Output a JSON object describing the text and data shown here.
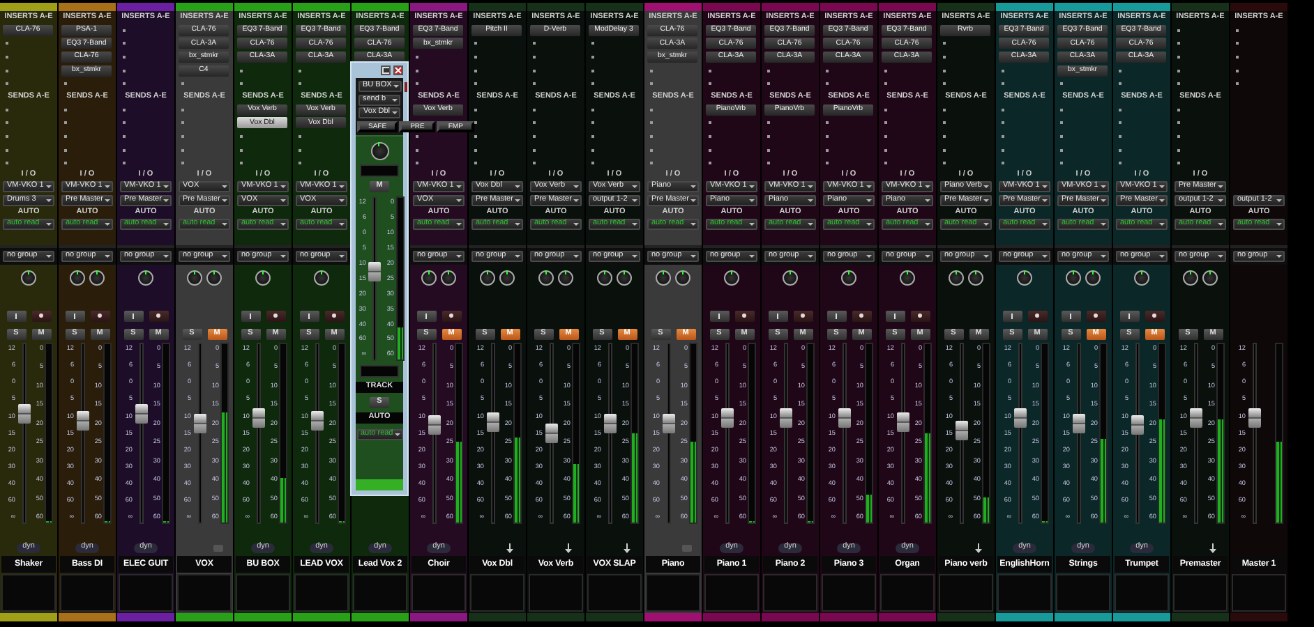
{
  "channels": [
    {
      "name": "Shaker",
      "kind": "audio",
      "color": "#a0a018",
      "selected": false,
      "stereo": false,
      "record_buttons": true,
      "muted": false,
      "inserts_label": "INSERTS A-E",
      "inserts": [
        "CLA-76"
      ],
      "sends_label": "SENDS A-E",
      "io_label": "I / O",
      "input": "VM-VKO 1",
      "output": "Drums 3",
      "auto_label": "AUTO",
      "automation": "auto read",
      "group": "no group",
      "solo_label": "S",
      "mute_label": "M",
      "dyn": "dyn",
      "fader": {
        "level": 0.62,
        "scale": [
          "12",
          "6",
          "0",
          "5",
          "10",
          "15",
          "20",
          "30",
          "40",
          "60",
          "∞"
        ]
      },
      "meter": {
        "level": 0,
        "scale": [
          "0",
          "5",
          "10",
          "15",
          "20",
          "25",
          "30",
          "40",
          "50",
          "60"
        ]
      }
    },
    {
      "name": "Bass DI",
      "kind": "audio",
      "color": "#a87018",
      "selected": false,
      "stereo": true,
      "record_buttons": true,
      "muted": false,
      "inserts_label": "INSERTS A-E",
      "inserts": [
        "PSA-1",
        "EQ3 7-Band",
        "CLA-76",
        "bx_stmkr"
      ],
      "sends_label": "SENDS A-E",
      "io_label": "I / O",
      "input": "VM-VKO 1",
      "output": "Pre Master",
      "auto_label": "AUTO",
      "automation": "auto read",
      "group": "no group",
      "solo_label": "S",
      "mute_label": "M",
      "dyn": "dyn",
      "fader": {
        "level": 0.58,
        "scale": [
          "12",
          "6",
          "0",
          "5",
          "10",
          "15",
          "20",
          "30",
          "40",
          "60",
          "∞"
        ]
      },
      "meter": {
        "level": 0,
        "scale": [
          "0",
          "5",
          "10",
          "15",
          "20",
          "25",
          "30",
          "40",
          "50",
          "60"
        ]
      }
    },
    {
      "name": "ELEC GUIT",
      "kind": "audio",
      "color": "#6a20a0",
      "selected": false,
      "stereo": false,
      "record_buttons": true,
      "muted": false,
      "inserts_label": "INSERTS A-E",
      "sends_label": "SENDS A-E",
      "io_label": "I / O",
      "input": "VM-VKO 1",
      "output": "Pre Master",
      "auto_label": "AUTO",
      "automation": "auto read",
      "group": "no group",
      "solo_label": "S",
      "mute_label": "M",
      "dyn": "dyn",
      "fader": {
        "level": 0.62,
        "scale": [
          "12",
          "6",
          "0",
          "5",
          "10",
          "15",
          "20",
          "30",
          "40",
          "60",
          "∞"
        ]
      },
      "meter": {
        "level": 0,
        "scale": [
          "0",
          "5",
          "10",
          "15",
          "20",
          "25",
          "30",
          "40",
          "50",
          "60"
        ]
      }
    },
    {
      "name": "VOX",
      "kind": "folder",
      "color": "#28a018",
      "selected": true,
      "stereo": true,
      "record_buttons": false,
      "muted": true,
      "inserts_label": "INSERTS A-E",
      "inserts": [
        "CLA-76",
        "CLA-3A",
        "bx_stmkr",
        "C4"
      ],
      "sends_label": "SENDS A-E",
      "io_label": "I / O",
      "input": "VOX",
      "output": "Pre Master",
      "auto_label": "AUTO",
      "automation": "auto read",
      "group": "no group",
      "solo_label": "S",
      "mute_label": "M",
      "fader": {
        "level": 0.56,
        "scale": [
          "12",
          "6",
          "0",
          "5",
          "10",
          "15",
          "20",
          "30",
          "40",
          "60",
          "∞"
        ]
      },
      "meter": {
        "level": 0.62,
        "scale": [
          "0",
          "5",
          "10",
          "15",
          "20",
          "25",
          "30",
          "40",
          "50",
          "60"
        ]
      }
    },
    {
      "name": "BU BOX",
      "kind": "audio",
      "color": "#28a018",
      "selected": false,
      "stereo": false,
      "record_buttons": true,
      "muted": false,
      "inserts_label": "INSERTS A-E",
      "inserts": [
        "EQ3 7-Band",
        "CLA-76",
        "CLA-3A"
      ],
      "sends_label": "SENDS A-E",
      "sends": [
        {
          "label": "Vox Verb",
          "selected": false
        },
        {
          "label": "Vox Dbl",
          "selected": true
        }
      ],
      "io_label": "I / O",
      "input": "VM-VKO 1",
      "output": "VOX",
      "auto_label": "AUTO",
      "automation": "auto read",
      "group": "no group",
      "solo_label": "S",
      "mute_label": "M",
      "dyn": "dyn",
      "fader": {
        "level": 0.6,
        "scale": [
          "12",
          "6",
          "0",
          "5",
          "10",
          "15",
          "20",
          "30",
          "40",
          "60",
          "∞"
        ]
      },
      "meter": {
        "level": 0.25,
        "scale": [
          "0",
          "5",
          "10",
          "15",
          "20",
          "25",
          "30",
          "40",
          "50",
          "60"
        ]
      }
    },
    {
      "name": "LEAD VOX",
      "kind": "audio",
      "color": "#28a018",
      "selected": false,
      "stereo": false,
      "record_buttons": true,
      "muted": false,
      "inserts_label": "INSERTS A-E",
      "inserts": [
        "EQ3 7-Band",
        "CLA-76",
        "CLA-3A"
      ],
      "sends_label": "SENDS A-E",
      "sends": [
        {
          "label": "Vox Verb",
          "selected": false
        },
        {
          "label": "Vox Dbl",
          "selected": false
        }
      ],
      "io_label": "I / O",
      "input": "VM-VKO 1",
      "output": "VOX",
      "auto_label": "AUTO",
      "automation": "auto read",
      "group": "no group",
      "solo_label": "S",
      "mute_label": "M",
      "dyn": "dyn",
      "fader": {
        "level": 0.58,
        "scale": [
          "12",
          "6",
          "0",
          "5",
          "10",
          "15",
          "20",
          "30",
          "40",
          "60",
          "∞"
        ]
      },
      "meter": {
        "level": 0,
        "scale": [
          "0",
          "5",
          "10",
          "15",
          "20",
          "25",
          "30",
          "40",
          "50",
          "60"
        ]
      }
    },
    {
      "name": "Lead Vox 2",
      "kind": "audio",
      "color": "#28a018",
      "selected": false,
      "inserts_label": "INSERTS A-E",
      "inserts": [
        "EQ3 7-Band",
        "CLA-76",
        "CLA-3A"
      ],
      "dyn": "dyn"
    },
    {
      "name": "Choir",
      "kind": "audio",
      "color": "#8a1880",
      "selected": false,
      "stereo": true,
      "record_buttons": true,
      "muted": true,
      "inserts_label": "INSERTS A-E",
      "inserts": [
        "EQ3 7-Band",
        "bx_stmkr"
      ],
      "sends_label": "SENDS A-E",
      "sends": [
        {
          "label": "Vox Verb",
          "selected": false
        }
      ],
      "io_label": "I / O",
      "input": "VM-VKO 1",
      "output": "VOX",
      "auto_label": "AUTO",
      "automation": "auto read",
      "group": "no group",
      "solo_label": "S",
      "mute_label": "M",
      "dyn": "dyn",
      "fader": {
        "level": 0.55,
        "scale": [
          "12",
          "6",
          "0",
          "5",
          "10",
          "15",
          "20",
          "30",
          "40",
          "60",
          "∞"
        ]
      },
      "meter": {
        "level": 0.45,
        "scale": [
          "0",
          "5",
          "10",
          "15",
          "20",
          "25",
          "30",
          "40",
          "50",
          "60"
        ]
      }
    },
    {
      "name": "Vox Dbl",
      "kind": "aux",
      "color": "#16301a",
      "selected": false,
      "stereo": true,
      "record_buttons": false,
      "muted": true,
      "inserts_label": "INSERTS A-E",
      "inserts": [
        "Pitch II"
      ],
      "sends_label": "SENDS A-E",
      "io_label": "I / O",
      "input": "Vox Dbl",
      "output": "Pre Master",
      "auto_label": "AUTO",
      "automation": "auto read",
      "group": "no group",
      "solo_label": "S",
      "mute_label": "M",
      "fader": {
        "level": 0.57,
        "scale": [
          "12",
          "6",
          "0",
          "5",
          "10",
          "15",
          "20",
          "30",
          "40",
          "60",
          "∞"
        ]
      },
      "meter": {
        "level": 0.48,
        "scale": [
          "0",
          "5",
          "10",
          "15",
          "20",
          "25",
          "30",
          "40",
          "50",
          "60"
        ]
      }
    },
    {
      "name": "Vox Verb",
      "kind": "aux",
      "color": "#16301a",
      "selected": false,
      "stereo": true,
      "record_buttons": false,
      "muted": true,
      "inserts_label": "INSERTS A-E",
      "inserts": [
        "D-Verb"
      ],
      "sends_label": "SENDS A-E",
      "io_label": "I / O",
      "input": "Vox Verb",
      "output": "Pre Master",
      "auto_label": "AUTO",
      "automation": "auto read",
      "group": "no group",
      "solo_label": "S",
      "mute_label": "M",
      "fader": {
        "level": 0.5,
        "scale": [
          "12",
          "6",
          "0",
          "5",
          "10",
          "15",
          "20",
          "30",
          "40",
          "60",
          "∞"
        ]
      },
      "meter": {
        "level": 0.33,
        "scale": [
          "0",
          "5",
          "10",
          "15",
          "20",
          "25",
          "30",
          "40",
          "50",
          "60"
        ]
      }
    },
    {
      "name": "VOX SLAP",
      "kind": "aux",
      "color": "#16301a",
      "selected": false,
      "stereo": true,
      "record_buttons": false,
      "muted": true,
      "inserts_label": "INSERTS A-E",
      "inserts": [
        "ModDelay 3"
      ],
      "sends_label": "SENDS A-E",
      "io_label": "I / O",
      "input": "Vox Verb",
      "output": "output 1-2",
      "auto_label": "AUTO",
      "automation": "auto read",
      "group": "no group",
      "solo_label": "S",
      "mute_label": "M",
      "fader": {
        "level": 0.56,
        "scale": [
          "12",
          "6",
          "0",
          "5",
          "10",
          "15",
          "20",
          "30",
          "40",
          "60",
          "∞"
        ]
      },
      "meter": {
        "level": 0.5,
        "scale": [
          "0",
          "5",
          "10",
          "15",
          "20",
          "25",
          "30",
          "40",
          "50",
          "60"
        ]
      }
    },
    {
      "name": "Piano",
      "kind": "folder",
      "color": "#a01070",
      "selected": true,
      "stereo": true,
      "record_buttons": false,
      "muted": true,
      "inserts_label": "INSERTS A-E",
      "inserts": [
        "CLA-76",
        "CLA-3A",
        "bx_stmkr"
      ],
      "sends_label": "SENDS A-E",
      "io_label": "I / O",
      "input": "Piano",
      "output": "Pre Master",
      "auto_label": "AUTO",
      "automation": "auto read",
      "group": "no group",
      "solo_label": "S",
      "mute_label": "M",
      "fader": {
        "level": 0.56,
        "scale": [
          "12",
          "6",
          "0",
          "5",
          "10",
          "15",
          "20",
          "30",
          "40",
          "60",
          "∞"
        ]
      },
      "meter": {
        "level": 0.45,
        "scale": [
          "0",
          "5",
          "10",
          "15",
          "20",
          "25",
          "30",
          "40",
          "50",
          "60"
        ]
      }
    },
    {
      "name": "Piano 1",
      "kind": "audio",
      "color": "#7a0850",
      "selected": false,
      "stereo": false,
      "record_buttons": true,
      "muted": false,
      "inserts_label": "INSERTS A-E",
      "inserts": [
        "EQ3 7-Band",
        "CLA-76",
        "CLA-3A"
      ],
      "sends_label": "SENDS A-E",
      "sends": [
        {
          "label": "PianoVrb",
          "selected": false
        }
      ],
      "io_label": "I / O",
      "input": "VM-VKO 1",
      "output": "Piano",
      "auto_label": "AUTO",
      "automation": "auto read",
      "group": "no group",
      "solo_label": "S",
      "mute_label": "M",
      "dyn": "dyn",
      "fader": {
        "level": 0.6,
        "scale": [
          "12",
          "6",
          "0",
          "5",
          "10",
          "15",
          "20",
          "30",
          "40",
          "60",
          "∞"
        ]
      },
      "meter": {
        "level": 0,
        "scale": [
          "0",
          "5",
          "10",
          "15",
          "20",
          "25",
          "30",
          "40",
          "50",
          "60"
        ]
      }
    },
    {
      "name": "Piano 2",
      "kind": "audio",
      "color": "#7a0850",
      "selected": false,
      "stereo": false,
      "record_buttons": true,
      "muted": false,
      "inserts_label": "INSERTS A-E",
      "inserts": [
        "EQ3 7-Band",
        "CLA-76",
        "CLA-3A"
      ],
      "sends_label": "SENDS A-E",
      "sends": [
        {
          "label": "PianoVrb",
          "selected": false
        }
      ],
      "io_label": "I / O",
      "input": "VM-VKO 1",
      "output": "Piano",
      "auto_label": "AUTO",
      "automation": "auto read",
      "group": "no group",
      "solo_label": "S",
      "mute_label": "M",
      "dyn": "dyn",
      "fader": {
        "level": 0.6,
        "scale": [
          "12",
          "6",
          "0",
          "5",
          "10",
          "15",
          "20",
          "30",
          "40",
          "60",
          "∞"
        ]
      },
      "meter": {
        "level": 0,
        "scale": [
          "0",
          "5",
          "10",
          "15",
          "20",
          "25",
          "30",
          "40",
          "50",
          "60"
        ]
      }
    },
    {
      "name": "Piano 3",
      "kind": "audio",
      "color": "#7a0850",
      "selected": false,
      "stereo": false,
      "record_buttons": true,
      "muted": false,
      "inserts_label": "INSERTS A-E",
      "inserts": [
        "EQ3 7-Band",
        "CLA-76",
        "CLA-3A"
      ],
      "sends_label": "SENDS A-E",
      "sends": [
        {
          "label": "PianoVrb",
          "selected": false
        }
      ],
      "io_label": "I / O",
      "input": "VM-VKO 1",
      "output": "Piano",
      "auto_label": "AUTO",
      "automation": "auto read",
      "group": "no group",
      "solo_label": "S",
      "mute_label": "M",
      "dyn": "dyn",
      "fader": {
        "level": 0.6,
        "scale": [
          "12",
          "6",
          "0",
          "5",
          "10",
          "15",
          "20",
          "30",
          "40",
          "60",
          "∞"
        ]
      },
      "meter": {
        "level": 0.16,
        "scale": [
          "0",
          "5",
          "10",
          "15",
          "20",
          "25",
          "30",
          "40",
          "50",
          "60"
        ]
      }
    },
    {
      "name": "Organ",
      "kind": "audio",
      "color": "#7a0850",
      "selected": false,
      "stereo": false,
      "record_buttons": true,
      "muted": false,
      "inserts_label": "INSERTS A-E",
      "inserts": [
        "EQ3 7-Band",
        "CLA-76",
        "CLA-3A"
      ],
      "sends_label": "SENDS A-E",
      "io_label": "I / O",
      "input": "VM-VKO 1",
      "output": "Piano",
      "auto_label": "AUTO",
      "automation": "auto read",
      "group": "no group",
      "solo_label": "S",
      "mute_label": "M",
      "dyn": "dyn",
      "fader": {
        "level": 0.57,
        "scale": [
          "12",
          "6",
          "0",
          "5",
          "10",
          "15",
          "20",
          "30",
          "40",
          "60",
          "∞"
        ]
      },
      "meter": {
        "level": 0.5,
        "scale": [
          "0",
          "5",
          "10",
          "15",
          "20",
          "25",
          "30",
          "40",
          "50",
          "60"
        ]
      }
    },
    {
      "name": "Piano verb",
      "kind": "aux",
      "color": "#16301a",
      "selected": false,
      "stereo": true,
      "record_buttons": false,
      "muted": false,
      "inserts_label": "INSERTS A-E",
      "inserts": [
        "Rvrb"
      ],
      "sends_label": "SENDS A-E",
      "io_label": "I / O",
      "input": "Piano Verb",
      "output": "Pre Master",
      "auto_label": "AUTO",
      "automation": "auto read",
      "group": "no group",
      "solo_label": "S",
      "mute_label": "M",
      "fader": {
        "level": 0.52,
        "scale": [
          "12",
          "6",
          "0",
          "5",
          "10",
          "15",
          "20",
          "30",
          "40",
          "60",
          "∞"
        ]
      },
      "meter": {
        "level": 0.14,
        "scale": [
          "0",
          "5",
          "10",
          "15",
          "20",
          "25",
          "30",
          "40",
          "50",
          "60"
        ]
      }
    },
    {
      "name": "EnglishHorn",
      "kind": "audio",
      "color": "#189a9a",
      "selected": false,
      "stereo": false,
      "record_buttons": true,
      "muted": false,
      "inserts_label": "INSERTS A-E",
      "inserts": [
        "EQ3 7-Band",
        "CLA-76",
        "CLA-3A"
      ],
      "sends_label": "SENDS A-E",
      "io_label": "I / O",
      "input": "VM-VKO 1",
      "output": "Pre Master",
      "auto_label": "AUTO",
      "automation": "auto read",
      "group": "no group",
      "solo_label": "S",
      "mute_label": "M",
      "dyn": "dyn",
      "fader": {
        "level": 0.6,
        "scale": [
          "12",
          "6",
          "0",
          "5",
          "10",
          "15",
          "20",
          "30",
          "40",
          "60",
          "∞"
        ]
      },
      "meter": {
        "level": 0,
        "scale": [
          "0",
          "5",
          "10",
          "15",
          "20",
          "25",
          "30",
          "40",
          "50",
          "60"
        ]
      }
    },
    {
      "name": "Strings",
      "kind": "audio",
      "color": "#189a9a",
      "selected": false,
      "stereo": true,
      "record_buttons": true,
      "muted": true,
      "inserts_label": "INSERTS A-E",
      "inserts": [
        "EQ3 7-Band",
        "CLA-76",
        "CLA-3A",
        "bx_stmkr"
      ],
      "sends_label": "SENDS A-E",
      "io_label": "I / O",
      "input": "VM-VKO 1",
      "output": "Pre Master",
      "auto_label": "AUTO",
      "automation": "auto read",
      "group": "no group",
      "solo_label": "S",
      "mute_label": "M",
      "dyn": "dyn",
      "fader": {
        "level": 0.56,
        "scale": [
          "12",
          "6",
          "0",
          "5",
          "10",
          "15",
          "20",
          "30",
          "40",
          "60",
          "∞"
        ]
      },
      "meter": {
        "level": 0.47,
        "scale": [
          "0",
          "5",
          "10",
          "15",
          "20",
          "25",
          "30",
          "40",
          "50",
          "60"
        ]
      }
    },
    {
      "name": "Trumpet",
      "kind": "audio",
      "color": "#189a9a",
      "selected": false,
      "stereo": false,
      "record_buttons": true,
      "muted": true,
      "inserts_label": "INSERTS A-E",
      "inserts": [
        "EQ3 7-Band",
        "CLA-76",
        "CLA-3A"
      ],
      "sends_label": "SENDS A-E",
      "io_label": "I / O",
      "input": "VM-VKO 1",
      "output": "Pre Master",
      "auto_label": "AUTO",
      "automation": "auto read",
      "group": "no group",
      "solo_label": "S",
      "mute_label": "M",
      "dyn": "dyn",
      "fader": {
        "level": 0.55,
        "scale": [
          "12",
          "6",
          "0",
          "5",
          "10",
          "15",
          "20",
          "30",
          "40",
          "60",
          "∞"
        ]
      },
      "meter": {
        "level": 0.58,
        "scale": [
          "0",
          "5",
          "10",
          "15",
          "20",
          "25",
          "30",
          "40",
          "50",
          "60"
        ]
      }
    },
    {
      "name": "Premaster",
      "kind": "aux",
      "color": "#16301a",
      "selected": false,
      "stereo": true,
      "record_buttons": false,
      "muted": false,
      "inserts_label": "INSERTS A-E",
      "sends_label": "SENDS A-E",
      "io_label": "I / O",
      "input": "Pre Master",
      "output": "output 1-2",
      "auto_label": "AUTO",
      "automation": "auto read",
      "group": "no group",
      "solo_label": "S",
      "mute_label": "M",
      "fader": {
        "level": 0.6,
        "scale": [
          "12",
          "6",
          "0",
          "5",
          "10",
          "15",
          "20",
          "30",
          "40",
          "60",
          "∞"
        ]
      },
      "meter": {
        "level": 0.58,
        "scale": [
          "0",
          "5",
          "10",
          "15",
          "20",
          "25",
          "30",
          "40",
          "50",
          "60"
        ]
      }
    },
    {
      "name": "Master 1",
      "kind": "master",
      "color": "#2a0a0a",
      "selected": false,
      "inserts_label": "INSERTS A-E",
      "output": "output 1-2",
      "auto_label": "AUTO",
      "automation": "auto read",
      "group": "no group",
      "fader": {
        "level": 0.6,
        "scale": [
          "12",
          "6",
          "0",
          "5",
          "10",
          "15",
          "20",
          "30",
          "40",
          "60",
          "∞"
        ]
      },
      "meter": {
        "level": 0.45
      }
    }
  ],
  "send_window": {
    "track": "BU BOX",
    "send": "send b",
    "destination": "Vox Dbl",
    "buttons": [
      "SAFE",
      "PRE",
      "FMP"
    ],
    "mute_label": "M",
    "fader": {
      "level": 0.55,
      "scale": [
        "12",
        "6",
        "0",
        "5",
        "10",
        "15",
        "20",
        "30",
        "40",
        "60",
        "∞"
      ]
    },
    "meter": {
      "level": 0.2,
      "scale": [
        "0",
        "5",
        "10",
        "15",
        "20",
        "25",
        "30",
        "35",
        "40",
        "50",
        "60"
      ]
    },
    "track_label": "TRACK",
    "solo_label": "S",
    "auto_label": "AUTO",
    "automation": "auto read"
  }
}
